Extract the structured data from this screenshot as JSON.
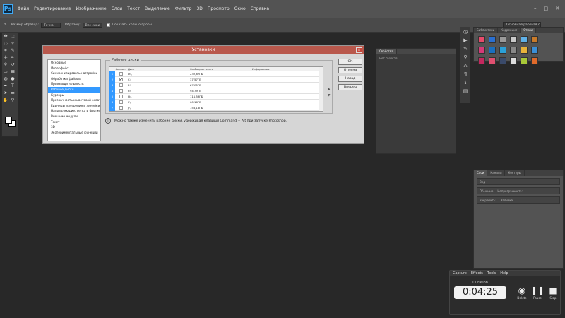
{
  "app": {
    "logo": "Ps"
  },
  "menu": [
    "Файл",
    "Редактирование",
    "Изображение",
    "Слои",
    "Текст",
    "Выделение",
    "Фильтр",
    "3D",
    "Просмотр",
    "Окно",
    "Справка"
  ],
  "window_controls": [
    "–",
    "□",
    "✕"
  ],
  "options_bar": {
    "sample_size_label": "Размер образца:",
    "sample_size_value": "Точка",
    "sample_label": "Образец:",
    "sample_value": "Все слои",
    "show_ring": "Показать кольцо пробы",
    "workspace": "Основная рабочая среда"
  },
  "dialog": {
    "title": "Установки",
    "close": "✕",
    "nav": [
      "Основные",
      "Интерфейс",
      "Синхронизировать настройки",
      "Обработка файлов",
      "Производительность",
      "Рабочие диски",
      "Курсоры",
      "Прозрачность и цветовой охват",
      "Единицы измерения и линейки",
      "Направляющие, сетка и фрагменты",
      "Внешние модули",
      "Текст",
      "3D",
      "Экспериментальные функции"
    ],
    "active_nav": 5,
    "group_title": "Рабочие диски",
    "columns": [
      "Актив...",
      "Диск",
      "Свободное место",
      "Информация"
    ],
    "disks": [
      {
        "num": "1",
        "checked": false,
        "disk": "D:\\",
        "free": "232,67ГБ",
        "info": ""
      },
      {
        "num": "2",
        "checked": true,
        "disk": "C:\\",
        "free": "37,57ГБ",
        "info": ""
      },
      {
        "num": "3",
        "checked": false,
        "disk": "E:\\",
        "free": "67,05ГБ",
        "info": ""
      },
      {
        "num": "4",
        "checked": false,
        "disk": "F:\\",
        "free": "94,79ГБ",
        "info": ""
      },
      {
        "num": "5",
        "checked": false,
        "disk": "H:\\",
        "free": "111,53ГБ",
        "info": ""
      },
      {
        "num": "6",
        "checked": false,
        "disk": "I:\\",
        "free": "60,16ГБ",
        "info": ""
      },
      {
        "num": "7",
        "checked": false,
        "disk": "J:\\",
        "free": "156,18ГБ",
        "info": ""
      }
    ],
    "info_icon": "i",
    "info_text": "Можно также изменить рабочие диски, удерживая клавиши Command + Alt при запуске Photoshop.",
    "buttons": {
      "ok": "ОК",
      "cancel": "Отмена",
      "back": "Назад",
      "forward": "Вперед"
    }
  },
  "swatches_panel": {
    "tabs": [
      "Библиотеки",
      "Коррекция",
      "Стили"
    ],
    "active_tab": 2,
    "swatch_colors": [
      "#e84a6a",
      "#2a6fd1",
      "#9a9a9a",
      "#c9c9c9",
      "#5fb0e8",
      "#c87a2a",
      "#d63a78",
      "#1a6fbf",
      "#2aa0d8",
      "#888888",
      "#e8b23a",
      "#3a8fd8",
      "#c4285e",
      "#e05070",
      "#3a4a6a",
      "#dcdcdc",
      "#a8c838",
      "#e06a2a"
    ]
  },
  "properties_panel": {
    "tab": "Свойства",
    "subtitle": "Нет свойств"
  },
  "layers_panel": {
    "tabs": [
      "Слои",
      "Каналы",
      "Контуры"
    ],
    "kind": "Вид",
    "blend": "Обычные",
    "opacity_label": "Непрозрачность:",
    "lock_label": "Закрепить:",
    "fill_label": "Заливка:"
  },
  "recorder": {
    "menu": [
      "Capture",
      "Effects",
      "Tools",
      "Help"
    ],
    "label": "Duration",
    "time": "0:04:25",
    "delete": "Delete",
    "pause": "Pause",
    "stop": "Stop"
  }
}
